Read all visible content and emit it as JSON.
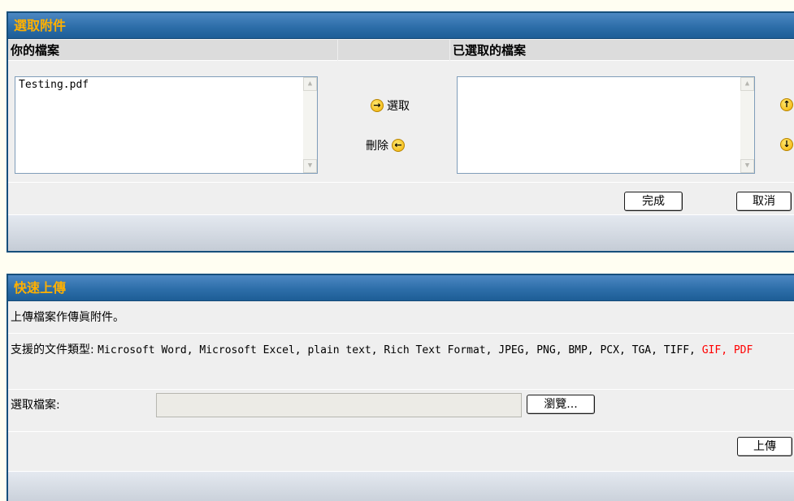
{
  "attach_panel": {
    "title": "選取附件",
    "your_files_label": "你的檔案",
    "selected_files_label": "已選取的檔案",
    "your_files": [
      "Testing.pdf"
    ],
    "selected_files": [],
    "select_label": "選取",
    "delete_label": "刪除",
    "done_label": "完成",
    "cancel_label": "取消",
    "icons": {
      "select": "arrow-right-circle-icon",
      "delete": "arrow-left-circle-icon",
      "move_up": "arrow-up-circle-icon",
      "move_down": "arrow-down-circle-icon"
    }
  },
  "upload_panel": {
    "title": "快速上傳",
    "description": "上傳檔案作傳眞附件。",
    "supported_prefix": "支援的文件類型:",
    "supported_types_text": "Microsoft Word, Microsoft Excel, plain text, Rich Text Format, JPEG, PNG, BMP, PCX, TGA, TIFF, ",
    "supported_types_highlight": "GIF, PDF",
    "highlight_color": "#ff0000",
    "file_label": "選取檔案:",
    "file_value": "",
    "browse_label": "瀏覽...",
    "upload_label": "上傳"
  },
  "colors": {
    "header_bg": "#2d6ea9",
    "header_text": "#ffb000",
    "border": "#164f7c",
    "page_bg": "#fffef2"
  }
}
